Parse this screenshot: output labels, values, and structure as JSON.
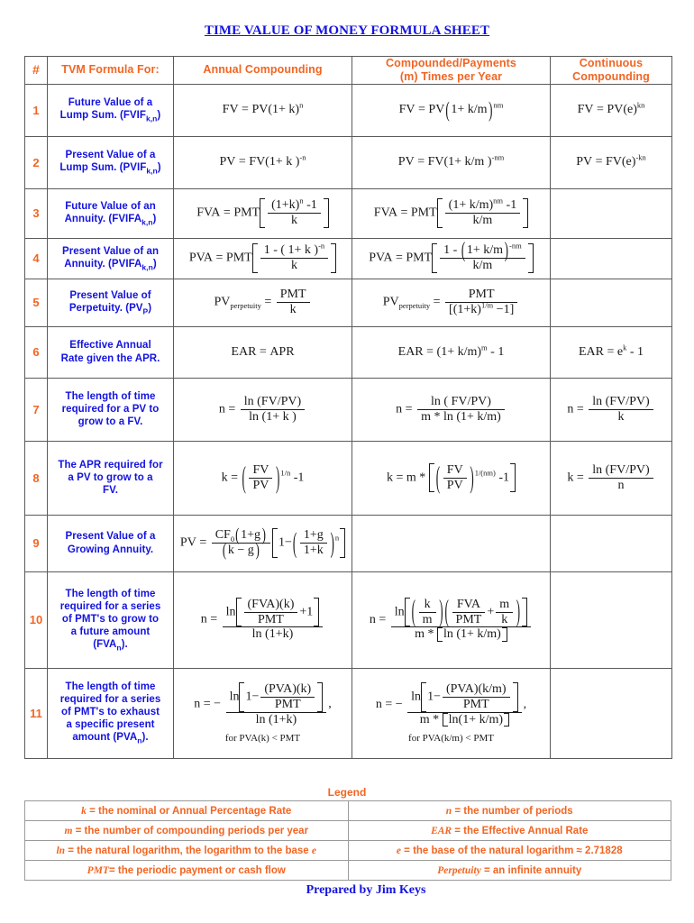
{
  "document": {
    "title": "TIME VALUE OF MONEY FORMULA SHEET",
    "prepared_by": "Prepared by Jim Keys"
  },
  "colors": {
    "heading_orange": "#F26522",
    "label_blue": "#1313E0",
    "formula_black": "#1A1A1A",
    "border_gray": "#5A5A5A"
  },
  "table": {
    "headers": {
      "num": "#",
      "formula_for": "TVM Formula For:",
      "annual": "Annual Compounding",
      "m_times_line1": "Compounded/Payments",
      "m_times_line2": "(m) Times per Year",
      "continuous_line1": "Continuous",
      "continuous_line2": "Compounding"
    },
    "rows": [
      {
        "num": "1",
        "label_line1": "Future Value of a",
        "label_line2": "Lump Sum. (FVIF",
        "label_sub": "k,n",
        "label_line3": ")",
        "annual_text": "FV = PV(1+ k)^n",
        "m_text": "FV = PV(1+ k/m)^nm",
        "continuous_text": "FV = PV(e)^kn"
      },
      {
        "num": "2",
        "label_line1": "Present Value of a",
        "label_line2": "Lump Sum. (PVIF",
        "label_sub": "k,n",
        "label_line3": ")",
        "annual_text": "PV = FV(1+ k)^-n",
        "m_text": "PV = FV(1+ k/m)^-nm",
        "continuous_text": "PV = FV(e)^-kn"
      },
      {
        "num": "3",
        "label_line1": "Future Value of an",
        "label_line2": "Annuity. (FVIFA",
        "label_sub": "k,n",
        "label_line3": ")",
        "annual_text": "FVA = PMT [ ((1+k)^n - 1) / k ]",
        "m_text": "FVA = PMT [ ((1+ k/m)^nm - 1) / (k/m) ]",
        "continuous_text": ""
      },
      {
        "num": "4",
        "label_line1": "Present Value of an",
        "label_line2": "Annuity. (PVIFA",
        "label_sub": "k,n",
        "label_line3": ")",
        "annual_text": "PVA = PMT [ (1 - (1+ k)^-n) / k ]",
        "m_text": "PVA = PMT [ (1 - (1+ k/m)^-nm) / (k/m) ]",
        "continuous_text": ""
      },
      {
        "num": "5",
        "label_line1": "Present Value of",
        "label_line2": "Perpetuity. (PV",
        "label_sub": "P",
        "label_line3": ")",
        "annual_text": "PV perpetuity = PMT / k",
        "m_text": "PV perpetuity = PMT / [(1+k)^(1/m) - 1]",
        "continuous_text": ""
      },
      {
        "num": "6",
        "label_line1": "Effective Annual",
        "label_line2": "Rate given the APR.",
        "label_sub": "",
        "label_line3": "",
        "annual_text": "EAR = APR",
        "m_text": "EAR = (1+ k/m)^m - 1",
        "continuous_text": "EAR = e^k - 1"
      },
      {
        "num": "7",
        "label_line1": "The length of time",
        "label_line2": "required for a PV to",
        "label_sub": "",
        "label_line3": "grow to a FV.",
        "annual_text": "n = ln (FV/PV) / ln (1+ k )",
        "m_text": "n = ln ( FV/PV) / (m * ln (1+ k/m))",
        "continuous_text": "n = ln (FV/PV) / k"
      },
      {
        "num": "8",
        "label_line1": "The APR required for",
        "label_line2": "a PV to grow to a",
        "label_sub": "",
        "label_line3": "FV.",
        "annual_text": "k = (FV/PV)^(1/n) - 1",
        "m_text": "k = m * [ (FV/PV)^(1/(nm)) - 1 ]",
        "continuous_text": "k = ln (FV/PV) / n"
      },
      {
        "num": "9",
        "label_line1": "Present Value of a",
        "label_line2": "Growing Annuity.",
        "label_sub": "",
        "label_line3": "",
        "annual_text": "PV = (CF0(1+g) / (k - g)) [ 1 - ((1+g)/(1+k))^n ]",
        "m_text": "",
        "continuous_text": ""
      },
      {
        "num": "10",
        "label_line1": "The length of time",
        "label_line2": "required for a series",
        "label_line3": "of PMT's to grow to",
        "label_line4": "a future amount",
        "label_line5": "(FVA",
        "label_sub": "n",
        "label_line6": ").",
        "annual_text": "n = ln [ ((FVA)(k) / PMT) + 1 ] / ln (1+k)",
        "m_text": "n = ln [ (k/m)(FVA/PMT + m/k) ] / (m * [ln (1+ k/m)])",
        "continuous_text": ""
      },
      {
        "num": "11",
        "label_line1": "The length of time",
        "label_line2": "required for a series",
        "label_line3": "of PMT's to exhaust",
        "label_line4": "a specific present",
        "label_line5": "amount (PVA",
        "label_sub": "n",
        "label_line6": ").",
        "annual_text": "n = - ln [ 1 - (PVA)(k)/PMT ] / ln (1+k) ,",
        "annual_note": "for PVA(k) < PMT",
        "m_text": "n = - ln [ 1 - (PVA)(k/m)/PMT ] / (m * [ln(1+ k/m)]) ,",
        "m_note": "for PVA(k/m) < PMT",
        "continuous_text": ""
      }
    ]
  },
  "legend": {
    "title": "Legend",
    "rows": [
      {
        "left_symbol": "k",
        "left_text": " = the nominal or Annual Percentage Rate",
        "right_symbol": "n",
        "right_text": " = the number of periods"
      },
      {
        "left_symbol": "m",
        "left_text": " = the number of compounding periods per year",
        "right_symbol": "EAR",
        "right_text": " = the Effective Annual Rate"
      },
      {
        "left_symbol": "ln",
        "left_text": " = the natural logarithm, the logarithm to the base ",
        "left_symbol2": "e",
        "right_symbol": "e",
        "right_text": " = the base of the natural logarithm ≈ 2.71828"
      },
      {
        "left_symbol": "PMT",
        "left_text": "= the periodic payment or cash flow",
        "right_symbol": "Perpetuity",
        "right_text": " = an infinite annuity"
      }
    ]
  }
}
